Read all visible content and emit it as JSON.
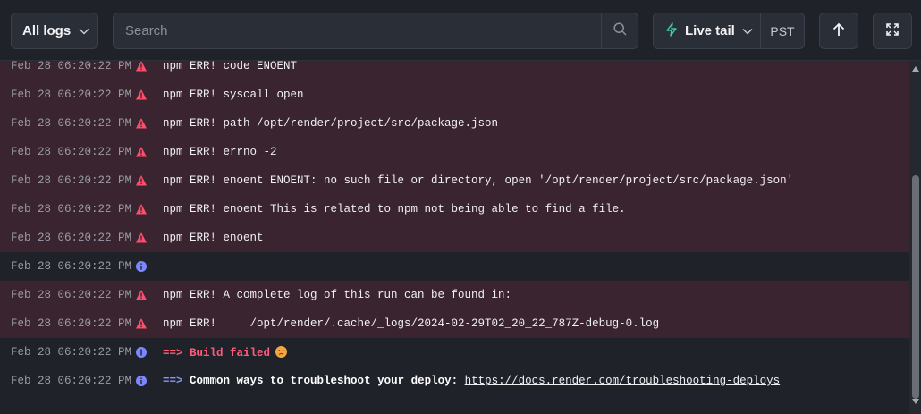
{
  "toolbar": {
    "log_filter_label": "All logs",
    "search_placeholder": "Search",
    "live_tail_label": "Live tail",
    "timezone_label": "PST"
  },
  "logs": [
    {
      "timestamp": "Feb 28 06:20:22 PM",
      "level": "error",
      "message": "npm ERR! code ENOENT"
    },
    {
      "timestamp": "Feb 28 06:20:22 PM",
      "level": "error",
      "message": "npm ERR! syscall open"
    },
    {
      "timestamp": "Feb 28 06:20:22 PM",
      "level": "error",
      "message": "npm ERR! path /opt/render/project/src/package.json"
    },
    {
      "timestamp": "Feb 28 06:20:22 PM",
      "level": "error",
      "message": "npm ERR! errno -2"
    },
    {
      "timestamp": "Feb 28 06:20:22 PM",
      "level": "error",
      "message": "npm ERR! enoent ENOENT: no such file or directory, open '/opt/render/project/src/package.json'"
    },
    {
      "timestamp": "Feb 28 06:20:22 PM",
      "level": "error",
      "message": "npm ERR! enoent This is related to npm not being able to find a file."
    },
    {
      "timestamp": "Feb 28 06:20:22 PM",
      "level": "error",
      "message": "npm ERR! enoent"
    },
    {
      "timestamp": "Feb 28 06:20:22 PM",
      "level": "info",
      "message": ""
    },
    {
      "timestamp": "Feb 28 06:20:22 PM",
      "level": "error",
      "message": "npm ERR! A complete log of this run can be found in:"
    },
    {
      "timestamp": "Feb 28 06:20:22 PM",
      "level": "error",
      "message": "npm ERR!     /opt/render/.cache/_logs/2024-02-29T02_20_22_787Z-debug-0.log"
    },
    {
      "timestamp": "Feb 28 06:20:22 PM",
      "level": "info",
      "arrow": "==>",
      "status_text": "Build failed",
      "status_icon": "sad-face-emoji"
    },
    {
      "timestamp": "Feb 28 06:20:22 PM",
      "level": "info",
      "arrow": "==>",
      "bold_text": "Common ways to troubleshoot your deploy:",
      "link_text": "https://docs.render.com/troubleshooting-deploys"
    }
  ],
  "colors": {
    "error_row_bg": "#3a2430",
    "error_icon": "#ff4d6d",
    "info_icon": "#7b86ff",
    "failed_text": "#ff5d7b"
  }
}
